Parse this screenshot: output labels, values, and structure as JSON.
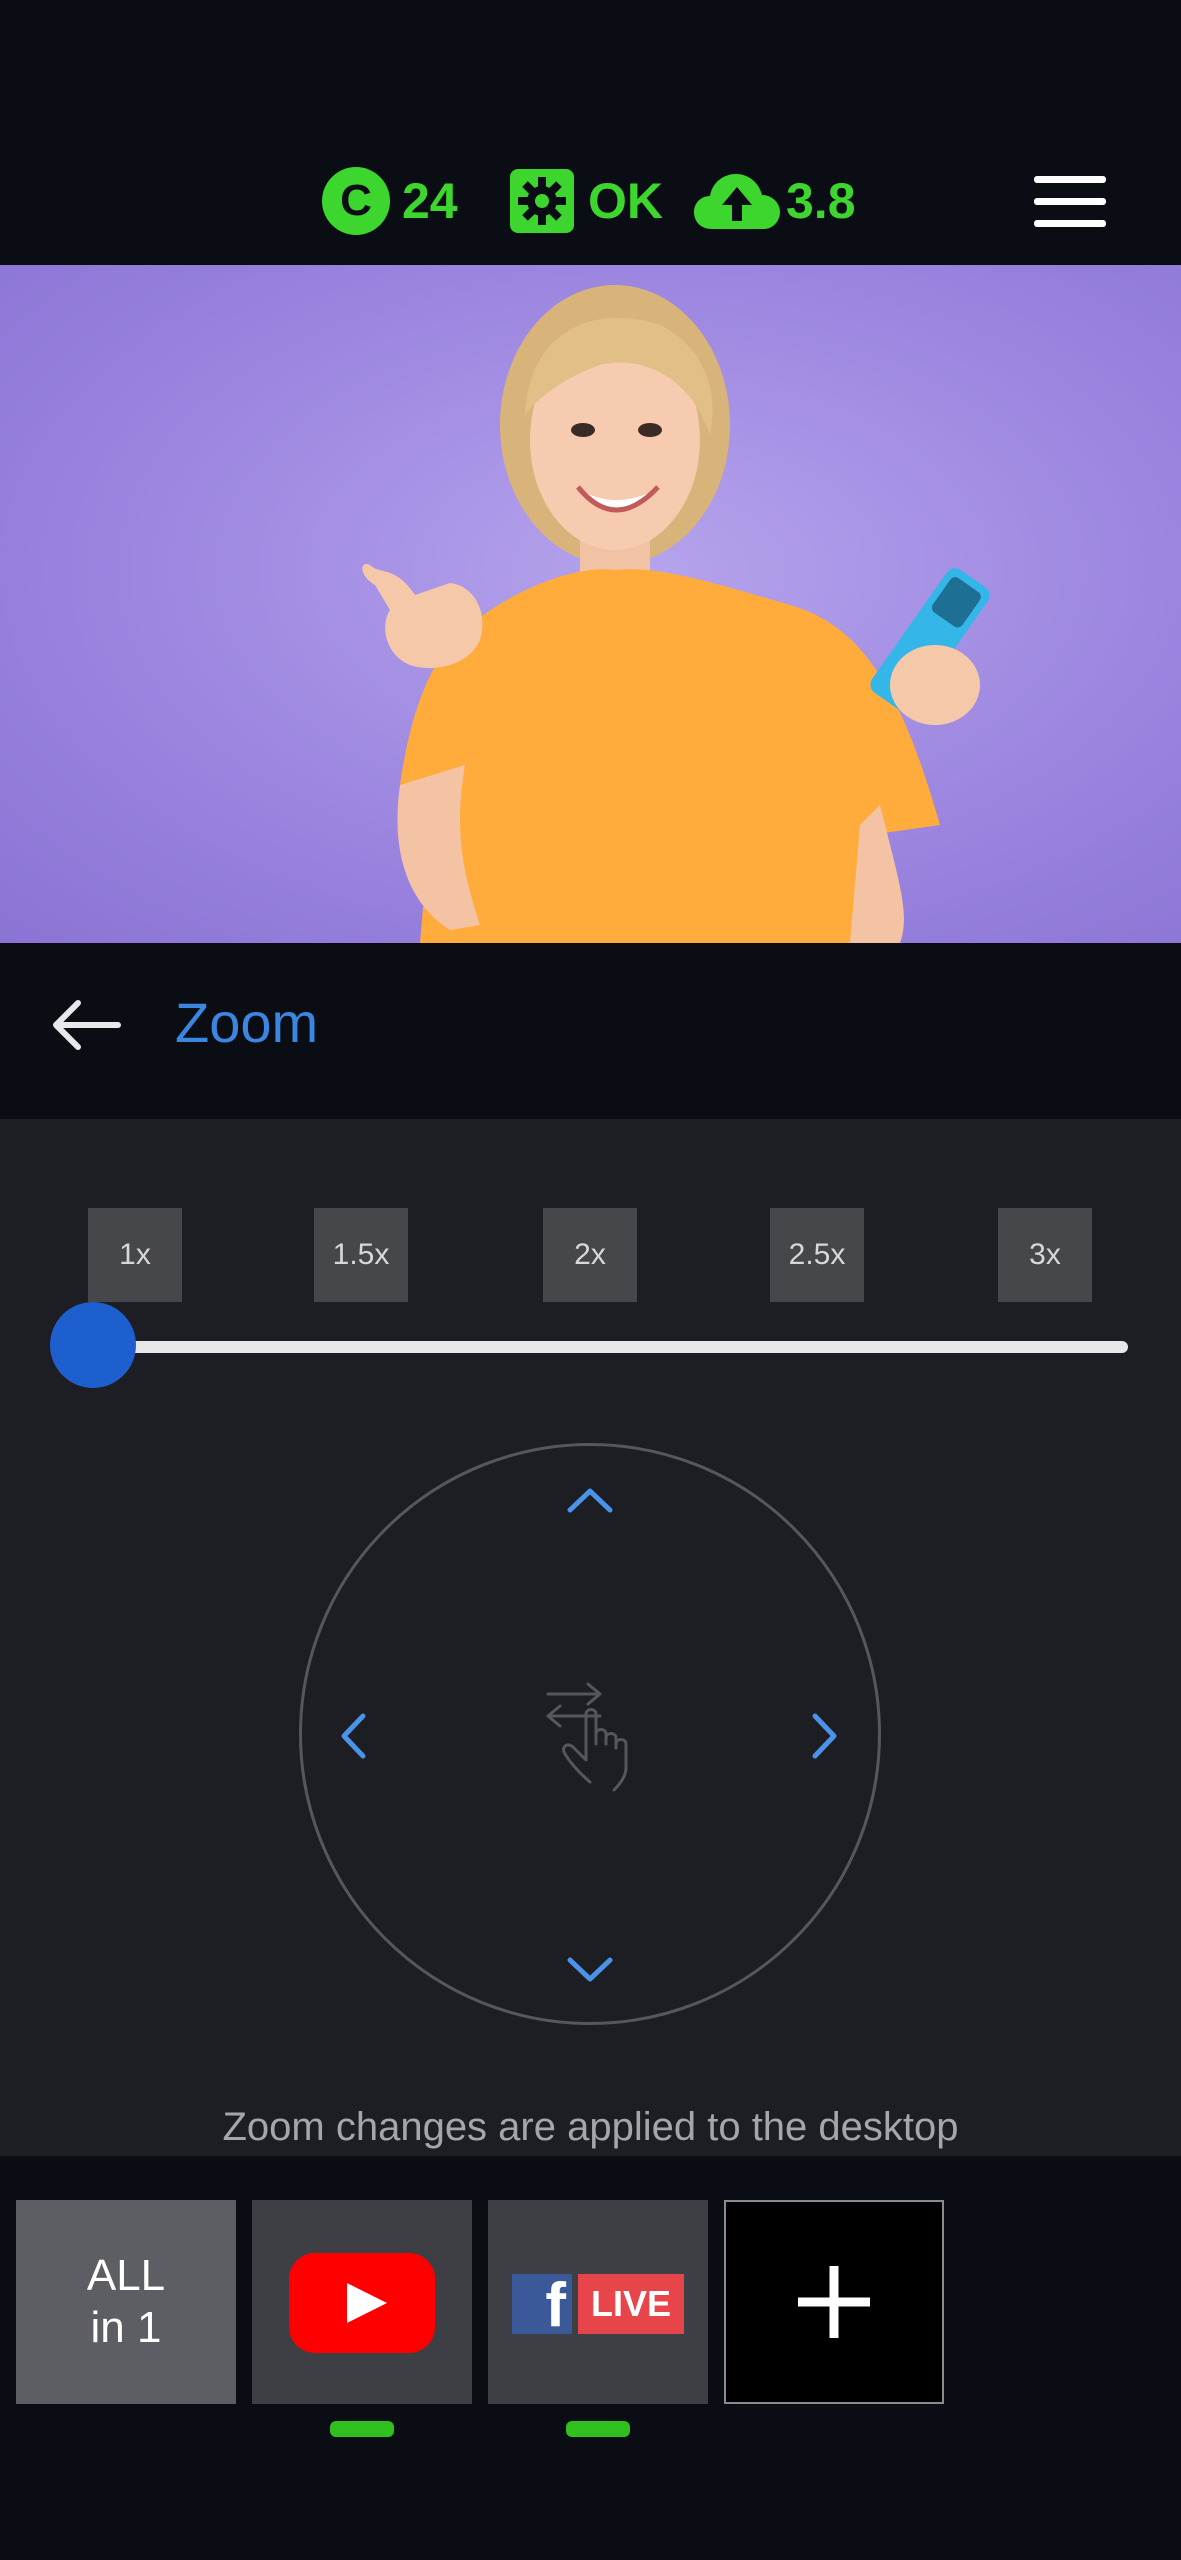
{
  "status": {
    "credits_icon_letter": "C",
    "credits": "24",
    "settings_status": "OK",
    "upload_speed": "3.8",
    "accent_color": "#3dd62e"
  },
  "zoom": {
    "title": "Zoom",
    "presets": [
      "1x",
      "1.5x",
      "2x",
      "2.5x",
      "3x"
    ],
    "slider_value_fraction": 0.0,
    "hint": "Zoom changes are applied to the desktop"
  },
  "destinations": {
    "all_in_one_line1": "ALL",
    "all_in_one_line2": "in 1",
    "facebook_live_label": "LIVE",
    "facebook_letter": "f"
  }
}
